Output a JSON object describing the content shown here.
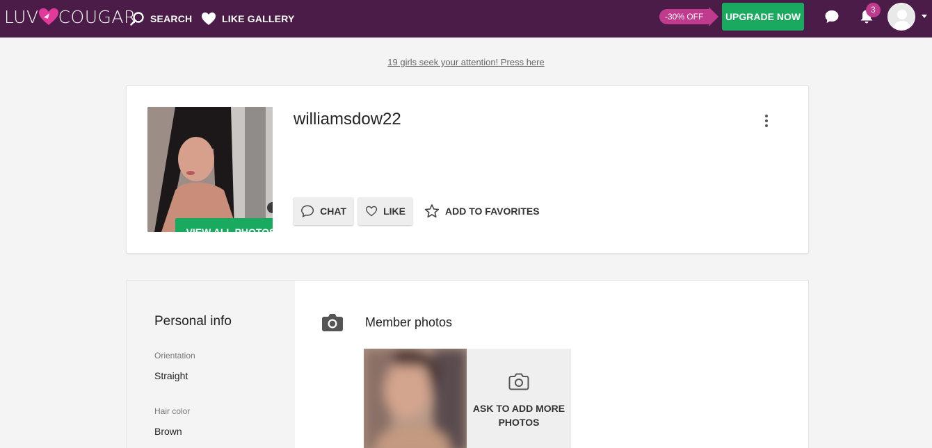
{
  "brand": {
    "left": "LUV",
    "right": "COUGAR"
  },
  "nav": {
    "search_label": "SEARCH",
    "like_gallery_label": "LIKE GALLERY"
  },
  "promo": {
    "discount": "-30% OFF",
    "upgrade_label": "UPGRADE NOW"
  },
  "notifications": {
    "count": "3"
  },
  "banner": {
    "attention_text": "19 girls seek your attention! Press here"
  },
  "profile": {
    "username": "williamsdow22",
    "view_all_photos_label": "VIEW ALL PHOTOS",
    "chat_label": "CHAT",
    "like_label": "LIKE",
    "favorites_label": "ADD TO FAVORITES"
  },
  "personal_info": {
    "title": "Personal info",
    "fields": [
      {
        "label": "Orientation",
        "value": "Straight"
      },
      {
        "label": "Hair color",
        "value": "Brown"
      }
    ]
  },
  "member_photos": {
    "title": "Member photos",
    "ask_more_label": "ASK TO ADD MORE PHOTOS"
  },
  "colors": {
    "topbar": "#4a1c47",
    "accent_green": "#1aaa5f",
    "accent_pink": "#c03b8e"
  },
  "icons": [
    "search-icon",
    "heart-icon",
    "chat-bubble-icon",
    "bell-icon",
    "user-avatar-icon",
    "more-vertical-icon",
    "star-outline-icon",
    "camera-icon"
  ]
}
